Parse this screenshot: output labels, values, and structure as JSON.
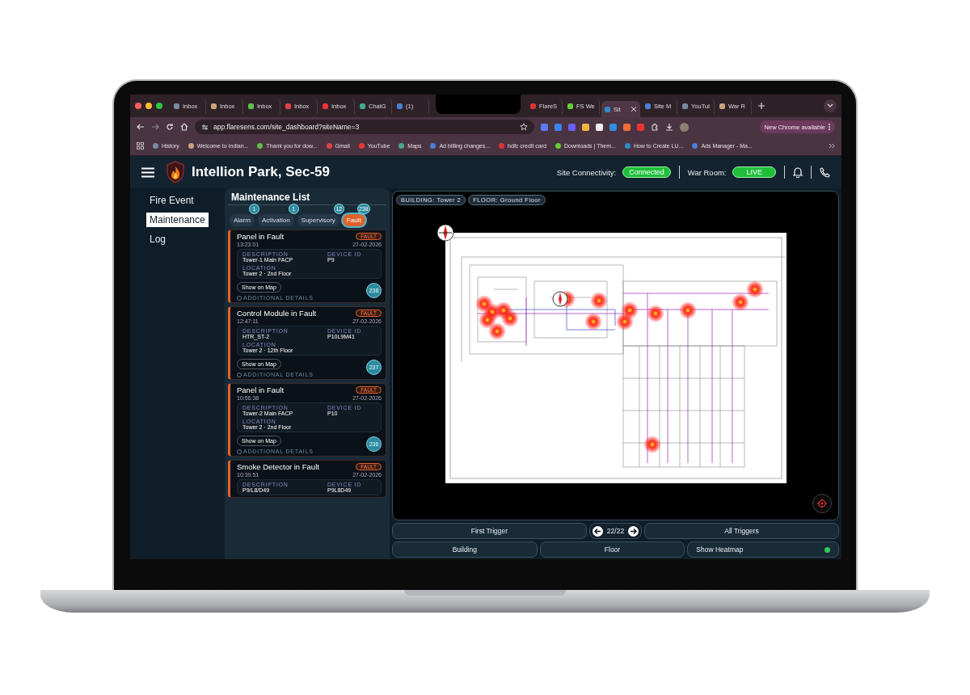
{
  "browser": {
    "tabs": [
      {
        "title": "Inbox",
        "selected": false
      },
      {
        "title": "Inbox",
        "selected": false
      },
      {
        "title": "Inbox",
        "selected": false
      },
      {
        "title": "Inbox",
        "selected": false
      },
      {
        "title": "Inbox",
        "selected": false
      },
      {
        "title": "ChatG",
        "selected": false
      },
      {
        "title": "(1)",
        "selected": false
      },
      {
        "title": "FlareS",
        "selected": false
      },
      {
        "title": "FS We",
        "selected": false
      },
      {
        "title": "Sit",
        "selected": true
      },
      {
        "title": "Site M",
        "selected": false
      },
      {
        "title": "YouTul",
        "selected": false
      },
      {
        "title": "War R",
        "selected": false
      }
    ],
    "url": "app.flaresens.com/site_dashboard?siteName=3",
    "update_button": "New Chrome available",
    "bookmarks": [
      "History",
      "Welcome to Indian...",
      "Thank you for dow...",
      "Gmail",
      "YouTube",
      "Maps",
      "Ad billing changes...",
      "hdfc credit card",
      "Downloads | Them...",
      "How to Create LU...",
      "Ads Manager - Ma..."
    ]
  },
  "header": {
    "site_name": "Intellion Park, Sec-59",
    "connectivity_label": "Site Connectivity:",
    "connectivity": "Connected",
    "war_room_label": "War Room:",
    "war_room": "LIVE"
  },
  "nav": [
    {
      "label": "Fire Event",
      "selected": false
    },
    {
      "label": "Maintenance",
      "selected": true
    },
    {
      "label": "Log",
      "selected": false
    }
  ],
  "maintenance": {
    "title": "Maintenance List",
    "filters": [
      {
        "label": "Alarm",
        "count": "1",
        "selected": false
      },
      {
        "label": "Activation",
        "count": "1",
        "selected": false
      },
      {
        "label": "Supervisory",
        "count": "12",
        "selected": false
      },
      {
        "label": "Fault",
        "count": "238",
        "selected": true
      }
    ],
    "cards": [
      {
        "title": "Panel in Fault",
        "time": "13:23:01",
        "status": "FAULT",
        "date": "27-02-2026",
        "description_label": "DESCRIPTION",
        "description": "Tower-1 Main FACP",
        "device_id_label": "DEVICE ID",
        "device_id": "P9",
        "location_label": "LOCATION",
        "location": "Tower 2 · 2nd Floor",
        "button": "Show on Map",
        "details": "ADDITIONAL DETAILS",
        "number": "238"
      },
      {
        "title": "Control Module in Fault",
        "time": "12:47:11",
        "status": "FAULT",
        "date": "27-02-2026",
        "description_label": "DESCRIPTION",
        "description": "HTR_ST-2",
        "device_id_label": "DEVICE ID",
        "device_id": "P10L9M41",
        "location_label": "LOCATION",
        "location": "Tower 2 · 12th Floor",
        "button": "Show on Map",
        "details": "ADDITIONAL DETAILS",
        "number": "237"
      },
      {
        "title": "Panel in Fault",
        "time": "10:56:38",
        "status": "FAULT",
        "date": "27-02-2026",
        "description_label": "DESCRIPTION",
        "description": "Tower-2 Main FACP",
        "device_id_label": "DEVICE ID",
        "device_id": "P10",
        "location_label": "LOCATION",
        "location": "Tower 2 · 2nd Floor",
        "button": "Show on Map",
        "details": "ADDITIONAL DETAILS",
        "number": "236"
      },
      {
        "title": "Smoke Detector in Fault",
        "time": "10:39:51",
        "status": "FAULT",
        "date": "27-02-2026",
        "description_label": "DESCRIPTION",
        "description": "P9/L8/D49",
        "device_id_label": "DEVICE ID",
        "device_id": "P9L8D49"
      }
    ]
  },
  "map": {
    "building": "BUILDING: Tower 2",
    "floor": "FLOOR: Ground Floor"
  },
  "controls": {
    "first_trigger": "First Trigger",
    "counter": "22/22",
    "all_triggers": "All Triggers",
    "building": "Building",
    "floor": "Floor",
    "heatmap": {
      "label": "Show Heatmap",
      "on": true
    }
  }
}
